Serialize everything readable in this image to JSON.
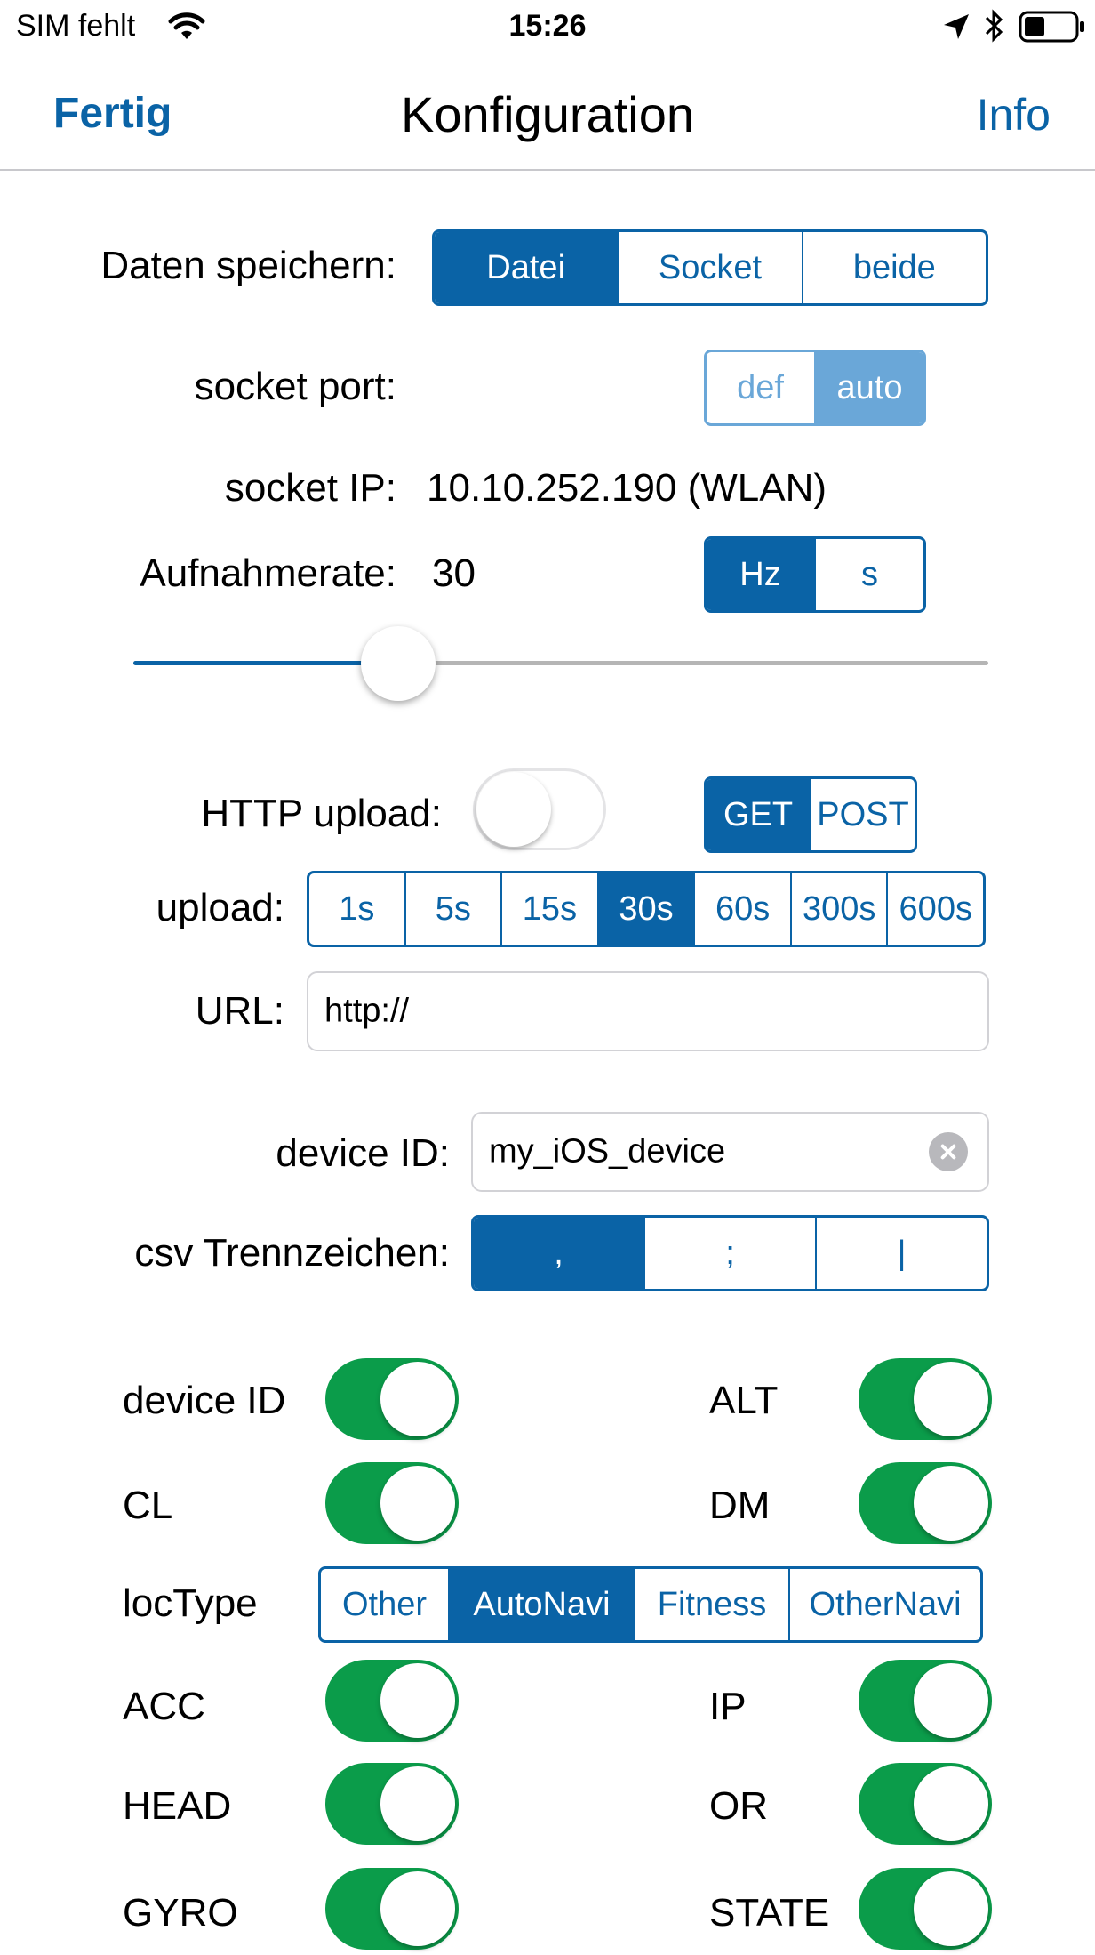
{
  "status_bar": {
    "carrier": "SIM fehlt",
    "time": "15:26"
  },
  "nav": {
    "left": "Fertig",
    "title": "Konfiguration",
    "right": "Info"
  },
  "save": {
    "label": "Daten speichern:",
    "options": [
      "Datei",
      "Socket",
      "beide"
    ],
    "selected": "Datei"
  },
  "port": {
    "label": "socket port:",
    "options": [
      "def",
      "auto"
    ],
    "selected": "auto"
  },
  "ip": {
    "label": "socket IP:",
    "value": "10.10.252.190 (WLAN)"
  },
  "rate": {
    "label": "Aufnahmerate:",
    "value": "30",
    "units": [
      "Hz",
      "s"
    ],
    "selected": "Hz",
    "slider_fraction": 0.31
  },
  "http": {
    "label": "HTTP upload:",
    "enabled": false,
    "methods": [
      "GET",
      "POST"
    ],
    "selected": "GET"
  },
  "upload": {
    "label": "upload:",
    "intervals": [
      "1s",
      "5s",
      "15s",
      "30s",
      "60s",
      "300s",
      "600s"
    ],
    "selected": "30s"
  },
  "url": {
    "label": "URL:",
    "value": "http://"
  },
  "device": {
    "label": "device ID:",
    "value": "my_iOS_device"
  },
  "csv": {
    "label": "csv Trennzeichen:",
    "options": [
      ",",
      ";",
      "|"
    ],
    "selected": ","
  },
  "toggles": {
    "device_id": {
      "label": "device ID",
      "on": true
    },
    "alt": {
      "label": "ALT",
      "on": true
    },
    "cl": {
      "label": "CL",
      "on": true
    },
    "dm": {
      "label": "DM",
      "on": true
    },
    "acc": {
      "label": "ACC",
      "on": true
    },
    "ip": {
      "label": "IP",
      "on": true
    },
    "head": {
      "label": "HEAD",
      "on": true
    },
    "or": {
      "label": "OR",
      "on": true
    },
    "gyro": {
      "label": "GYRO",
      "on": true
    },
    "state": {
      "label": "STATE",
      "on": true
    }
  },
  "loctype": {
    "label": "locType",
    "options": [
      "Other",
      "AutoNavi",
      "Fitness",
      "OtherNavi"
    ],
    "selected": "AutoNavi"
  },
  "colors": {
    "accent": "#0a63a6",
    "accent_light": "#6aa7d8",
    "toggle_on": "#0b9c4a"
  }
}
